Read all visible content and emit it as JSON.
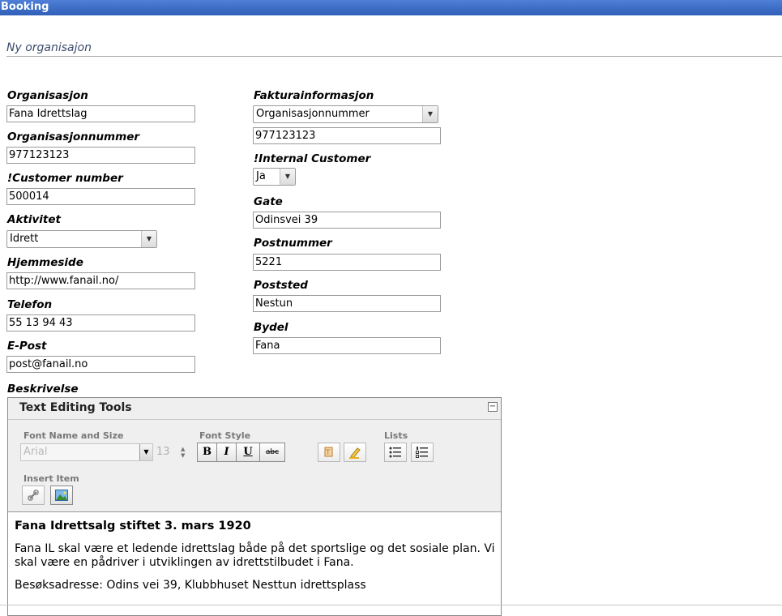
{
  "header": {
    "title": "Booking"
  },
  "page": {
    "subtitle": "Ny organisajon"
  },
  "left_fields": {
    "organisasjon": {
      "label": "Organisasjon",
      "value": "Fana Idrettslag"
    },
    "orgnr": {
      "label": "Organisasjonnummer",
      "value": "977123123"
    },
    "customer_number": {
      "label": "!Customer number",
      "value": "500014"
    },
    "aktivitet": {
      "label": "Aktivitet",
      "value": "Idrett"
    },
    "hjemmeside": {
      "label": "Hjemmeside",
      "value": "http://www.fanail.no/"
    },
    "telefon": {
      "label": "Telefon",
      "value": "55 13 94 43"
    },
    "epost": {
      "label": "E-Post",
      "value": "post@fanail.no"
    },
    "beskrivelse": {
      "label": "Beskrivelse"
    }
  },
  "right_fields": {
    "faktura": {
      "label": "Fakturainformasjon",
      "select": "Organisasjonnummer",
      "value": "977123123"
    },
    "internal_customer": {
      "label": "!Internal Customer",
      "value": "Ja"
    },
    "gate": {
      "label": "Gate",
      "value": "Odinsvei 39"
    },
    "postnummer": {
      "label": "Postnummer",
      "value": "5221"
    },
    "poststed": {
      "label": "Poststed",
      "value": "Nestun"
    },
    "bydel": {
      "label": "Bydel",
      "value": "Fana"
    }
  },
  "editor": {
    "title": "Text Editing Tools",
    "collapse_symbol": "−",
    "groups": {
      "font_name_size": "Font Name and Size",
      "font_style": "Font Style",
      "lists": "Lists",
      "insert_item": "Insert Item"
    },
    "font_name": "Arial",
    "font_size": "13",
    "style_buttons": {
      "bold": "B",
      "italic": "I",
      "underline": "U",
      "strike": "abc"
    },
    "icons": [
      "dropdown-arrow-icon",
      "spinner-icon",
      "text-color-icon",
      "highlight-icon",
      "bullet-list-icon",
      "numbered-list-icon",
      "link-icon",
      "image-icon"
    ],
    "content": {
      "heading": "Fana Idrettsalg stiftet 3. mars 1920",
      "paragraph1": "Fana IL skal være et ledende idrettslag både på det sportslige og det sosiale plan. Vi skal være en pådriver i utviklingen av idrettstilbudet i Fana.",
      "paragraph2": "Besøksadresse: Odins vei 39, Klubbhuset Nesttun idrettsplass"
    }
  }
}
